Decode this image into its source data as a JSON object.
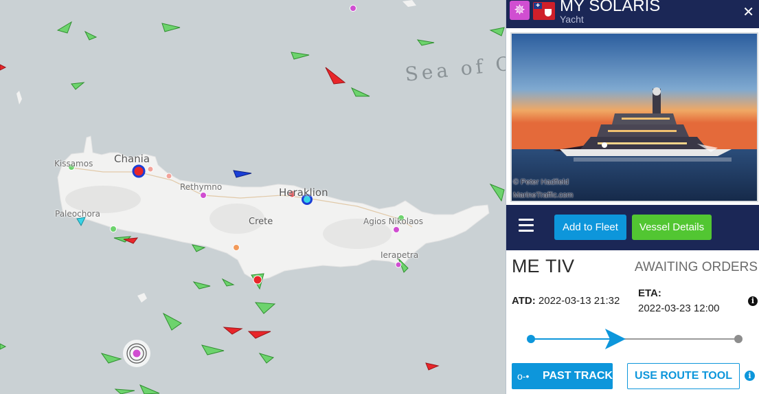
{
  "map": {
    "sea_label": "Sea of Cr",
    "places": [
      {
        "id": "kissamos",
        "label": "Kissamos"
      },
      {
        "id": "chania",
        "label": "Chania"
      },
      {
        "id": "rethymno",
        "label": "Rethymno"
      },
      {
        "id": "heraklion",
        "label": "Heraklion"
      },
      {
        "id": "crete",
        "label": "Crete"
      },
      {
        "id": "agios",
        "label": "Agios Nikolaos"
      },
      {
        "id": "paleochora",
        "label": "Paleochora"
      },
      {
        "id": "ierapetra",
        "label": "Ierapetra"
      }
    ]
  },
  "vessel": {
    "name": "MY SOLARIS",
    "type": "Yacht",
    "type_icon": "ship-wheel-icon",
    "flag_icon": "bermuda-flag-icon",
    "close_icon": "close-icon",
    "photo_credit": "© Peter Hadfield",
    "photo_source": "MarineTraffic.com"
  },
  "toolbar": {
    "menu_icon": "hamburger-menu-icon",
    "add_fleet": "Add to Fleet",
    "vessel_details": "Vessel Details"
  },
  "voyage": {
    "from_port": "ME",
    "to_port": "TIV",
    "status": "AWAITING ORDERS",
    "atd_label": "ATD:",
    "atd_value": "2022-03-13 21:32",
    "eta_label": "ETA:",
    "eta_value": "2022-03-23 12:00",
    "progress": 0.45
  },
  "actions": {
    "past_track": "PAST TRACK",
    "route_tool": "USE ROUTE TOOL"
  },
  "colors": {
    "header": "#1b2756",
    "accent_blue": "#0d96db",
    "accent_green": "#52c632",
    "vessel_cargo": "#6dd36d",
    "vessel_tanker": "#e8262a",
    "vessel_pleasure": "#d04ed1"
  }
}
